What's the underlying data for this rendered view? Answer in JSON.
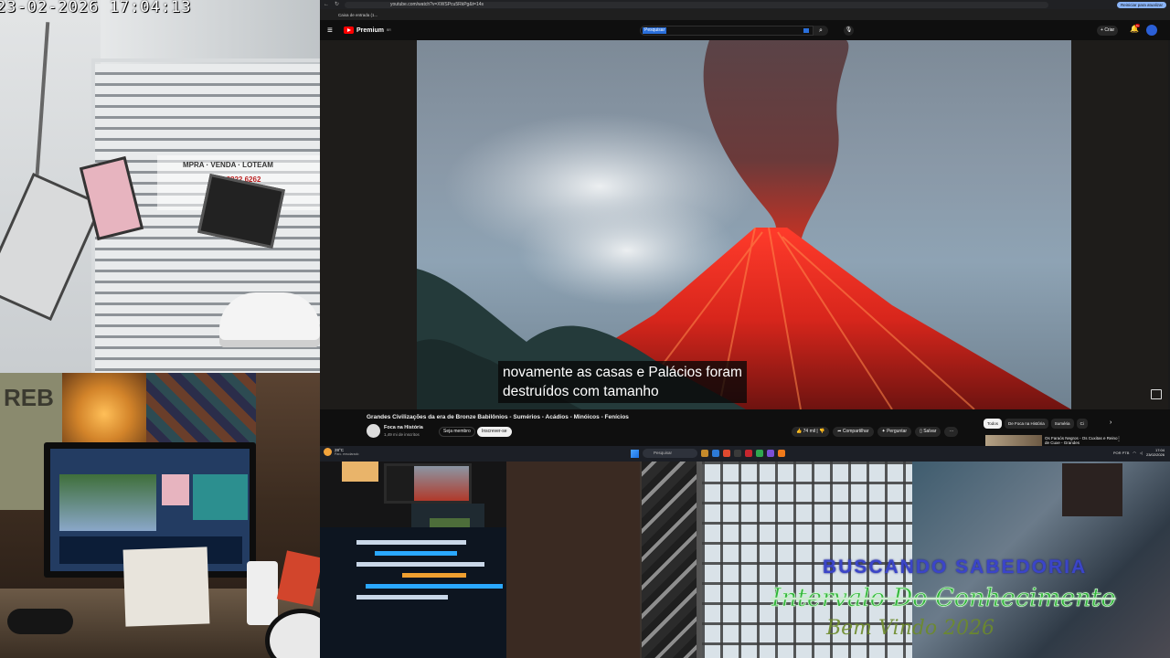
{
  "camera": {
    "timestamp": "23-02-2026 17:04:13",
    "sign_text": [
      "MPRA · VENDA · LOTEAM",
      "065 3822 6262"
    ]
  },
  "browser": {
    "url": "youtube.com/watch?v=XWSPcu5RkPg&t=14s",
    "bookmark": "Caixa de entrada (1...",
    "update_button": "Reiniciar para atualizar"
  },
  "youtube": {
    "brand": "Premium",
    "brand_sup": "BR",
    "search_placeholder": "Pesquisar",
    "create_label": "Criar",
    "notifications_badge": "9+",
    "subtitle_lines": [
      "novamente as casas e Palácios foram",
      "destruídos com tamanho"
    ],
    "video_title": "Grandes Civilizações da era de Bronze Babilônios - Sumérios - Acádios - Minóicos - Fenícios",
    "channel_name": "Foca na História",
    "subscribers": "1,49 mi de inscritos",
    "join_label": "Seja membro",
    "subscribe_label": "Inscrever-se",
    "actions": {
      "likes": "74 mil",
      "share": "Compartilhar",
      "ask": "Perguntar",
      "save": "Salvar",
      "more": "···"
    },
    "chips": [
      {
        "label": "Todos",
        "active": true
      },
      {
        "label": "De Foca na História",
        "active": false
      },
      {
        "label": "Suméria",
        "active": false
      },
      {
        "label": "Ci",
        "active": false
      }
    ],
    "rec_title": "Os Faraós Negros - Os Cuxitas e Reino de Cuxe - Grandes"
  },
  "taskbar": {
    "temp": "28°C",
    "weather": "Parc. ensolarado",
    "search": "Pesquisar",
    "lang": "POR",
    "lang2": "PTB",
    "time": "17:04",
    "date": "23/02/2026"
  },
  "desk_cam": {
    "poster_text": "REB"
  },
  "overlay": {
    "line1": "BUSCANDO SABEDORIA",
    "line2": "Intervalo Do Conhecimento",
    "line3": "Bem Vindo 2026"
  },
  "colors": {
    "yt_red": "#ff0000",
    "overlay_blue": "#3b45c8",
    "overlay_green": "#2fb338"
  }
}
